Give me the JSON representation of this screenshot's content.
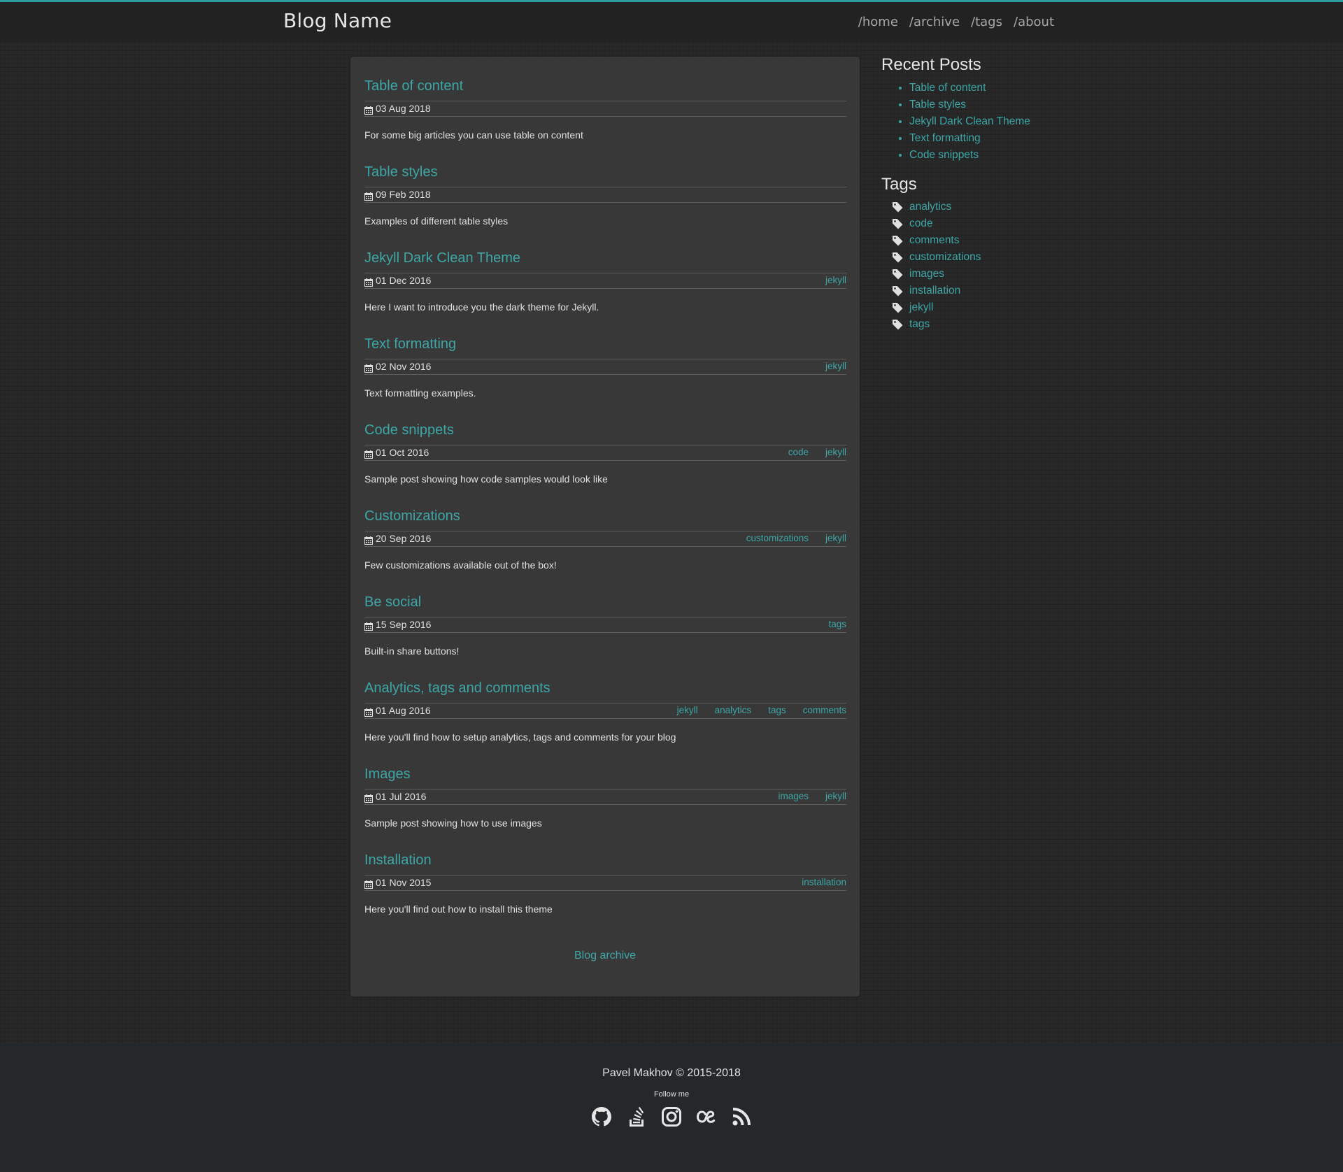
{
  "header": {
    "brand": "Blog Name",
    "nav": [
      "/home",
      "/archive",
      "/tags",
      "/about"
    ]
  },
  "posts": [
    {
      "title": "Table of content",
      "date": "03 Aug 2018",
      "tags": [],
      "excerpt": "For some big articles you can use table on content"
    },
    {
      "title": "Table styles",
      "date": "09 Feb 2018",
      "tags": [],
      "excerpt": "Examples of different table styles"
    },
    {
      "title": "Jekyll Dark Clean Theme",
      "date": "01 Dec 2016",
      "tags": [
        "jekyll"
      ],
      "excerpt": "Here I want to introduce you the dark theme for Jekyll."
    },
    {
      "title": "Text formatting",
      "date": "02 Nov 2016",
      "tags": [
        "jekyll"
      ],
      "excerpt": "Text formatting examples."
    },
    {
      "title": "Code snippets",
      "date": "01 Oct 2016",
      "tags": [
        "code",
        "jekyll"
      ],
      "excerpt": "Sample post showing how code samples would look like"
    },
    {
      "title": "Customizations",
      "date": "20 Sep 2016",
      "tags": [
        "customizations",
        "jekyll"
      ],
      "excerpt": "Few customizations available out of the box!"
    },
    {
      "title": "Be social",
      "date": "15 Sep 2016",
      "tags": [
        "tags"
      ],
      "excerpt": "Built-in share buttons!"
    },
    {
      "title": "Analytics, tags and comments",
      "date": "01 Aug 2016",
      "tags": [
        "jekyll",
        "analytics",
        "tags",
        "comments"
      ],
      "excerpt": "Here you'll find how to setup analytics, tags and comments for your blog"
    },
    {
      "title": "Images",
      "date": "01 Jul 2016",
      "tags": [
        "images",
        "jekyll"
      ],
      "excerpt": "Sample post showing how to use images"
    },
    {
      "title": "Installation",
      "date": "01 Nov 2015",
      "tags": [
        "installation"
      ],
      "excerpt": "Here you'll find out how to install this theme"
    }
  ],
  "archive_link": "Blog archive",
  "sidebar": {
    "recent_title": "Recent Posts",
    "recent": [
      "Table of content",
      "Table styles",
      "Jekyll Dark Clean Theme",
      "Text formatting",
      "Code snippets"
    ],
    "tags_title": "Tags",
    "tags": [
      "analytics",
      "code",
      "comments",
      "customizations",
      "images",
      "installation",
      "jekyll",
      "tags"
    ]
  },
  "footer": {
    "copyright": "Pavel Makhov © 2015-2018",
    "follow": "Follow me",
    "social_icons": [
      "github-icon",
      "stackoverflow-icon",
      "instagram-icon",
      "lastfm-icon",
      "rss-icon"
    ]
  },
  "colors": {
    "accent": "#3ea6a6",
    "top_border": "#2a9d9d",
    "card": "#383838",
    "header": "#222222",
    "footer": "#25282a"
  }
}
